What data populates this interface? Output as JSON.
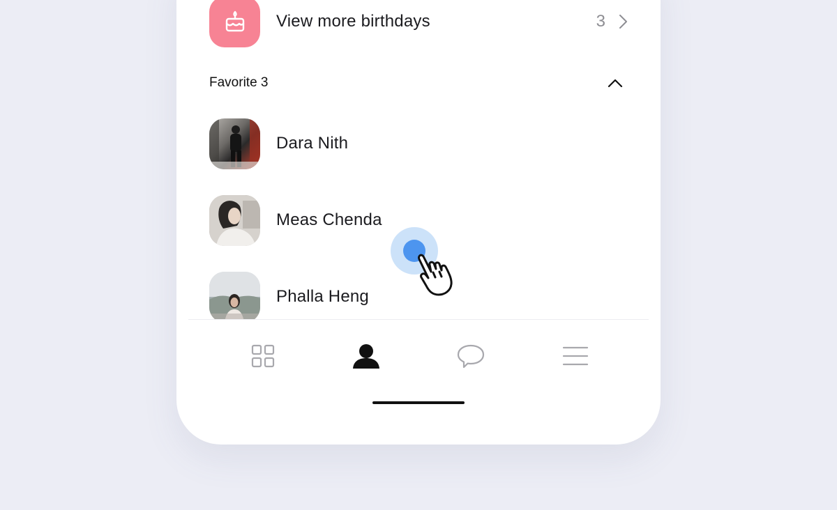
{
  "birthdays": {
    "icon": "cake-icon",
    "label": "View more birthdays",
    "count": "3"
  },
  "favorites": {
    "title": "Favorite 3",
    "contacts": [
      {
        "name": "Dara Nith"
      },
      {
        "name": "Meas Chenda"
      },
      {
        "name": "Phalla Heng"
      }
    ]
  },
  "tabbar": {
    "tabs": [
      {
        "icon": "grid-icon",
        "active": false
      },
      {
        "icon": "person-icon",
        "active": true
      },
      {
        "icon": "chat-bubble-icon",
        "active": false
      },
      {
        "icon": "menu-icon",
        "active": false
      }
    ]
  },
  "colors": {
    "background": "#ecedf5",
    "cake_tile": "#f78394",
    "touch_indicator": "#4d95ef",
    "active_tab": "#111111",
    "inactive_tab": "#a8a8ad"
  }
}
